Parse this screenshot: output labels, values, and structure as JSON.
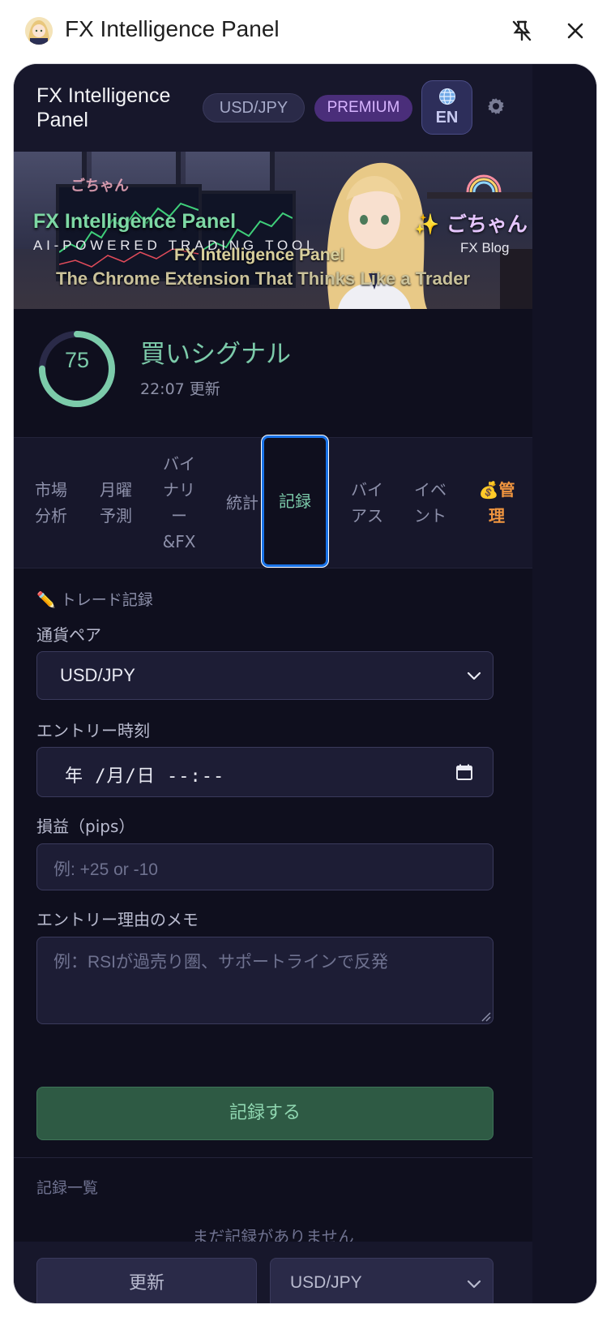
{
  "chrome": {
    "title": "FX Intelligence Panel",
    "avatar_icon": "anime-avatar-icon",
    "unpin_icon": "unpin-icon",
    "close_icon": "close-icon"
  },
  "header": {
    "title": "FX Intelligence Panel",
    "pair_badge": "USD/JPY",
    "premium_badge": "PREMIUM",
    "lang_code": "EN",
    "lang_icon": "globe-icon",
    "settings_icon": "gear-icon"
  },
  "banner": {
    "title": "FX Intelligence Panel",
    "subtitle": "AI-POWERED TRADING TOOL",
    "line1": "FX Intelligence Panel",
    "line2": "The Chrome Extension That Thinks Like a Trader",
    "brand": "✨ ごちゃん",
    "blog": "FX Blog",
    "tag": "ごちゃん"
  },
  "signal": {
    "score": "75",
    "score_fraction": 0.75,
    "label": "買いシグナル",
    "updated": "22:07 更新"
  },
  "tabs": [
    {
      "label": "市場\n分析"
    },
    {
      "label": "月曜\n予測"
    },
    {
      "label": "バイ\nナリ\nー\n&FX"
    },
    {
      "label": "統計"
    },
    {
      "label": "記録"
    },
    {
      "label": "バイ\nアス"
    },
    {
      "label": "イベ\nント"
    },
    {
      "label": "💰管\n理"
    }
  ],
  "form": {
    "section_title": "✏️ トレード記録",
    "pair_label": "通貨ペア",
    "pair_value": "USD/JPY",
    "entry_time_label": "エントリー時刻",
    "entry_time_value": "年 /月/日 --:--",
    "pips_label": "損益（pips）",
    "pips_placeholder": "例: +25 or -10",
    "memo_label": "エントリー理由のメモ",
    "memo_placeholder": "例：RSIが過売り圏、サポートラインで反発",
    "submit_label": "記録する",
    "list_title": "記録一覧",
    "empty_text": "まだ記録がありません"
  },
  "footer": {
    "refresh_label": "更新",
    "pair_value": "USD/JPY"
  },
  "colors": {
    "panel_bg": "#0f0f1e",
    "accent_green": "#7ccbaa",
    "premium": "#d7b4ff",
    "admin_orange": "#f0953f",
    "focus_blue": "#1a73e8"
  }
}
